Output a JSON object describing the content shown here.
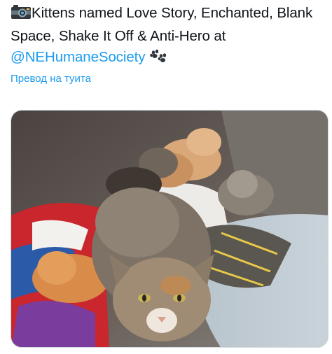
{
  "tweet": {
    "camera_icon": "camera-flash-icon",
    "text_main": "Kittens named Love Story, Enchanted, Blank Space, Shake It Off & Anti-Hero at",
    "mention": "@NEHumaneSociety",
    "paw_icon": "paw-prints-icon",
    "translate_label": "Превод на туита"
  },
  "media": {
    "alt": "Tabby cat with kittens"
  },
  "colors": {
    "link": "#1d9bf0",
    "text": "#0f1419"
  }
}
